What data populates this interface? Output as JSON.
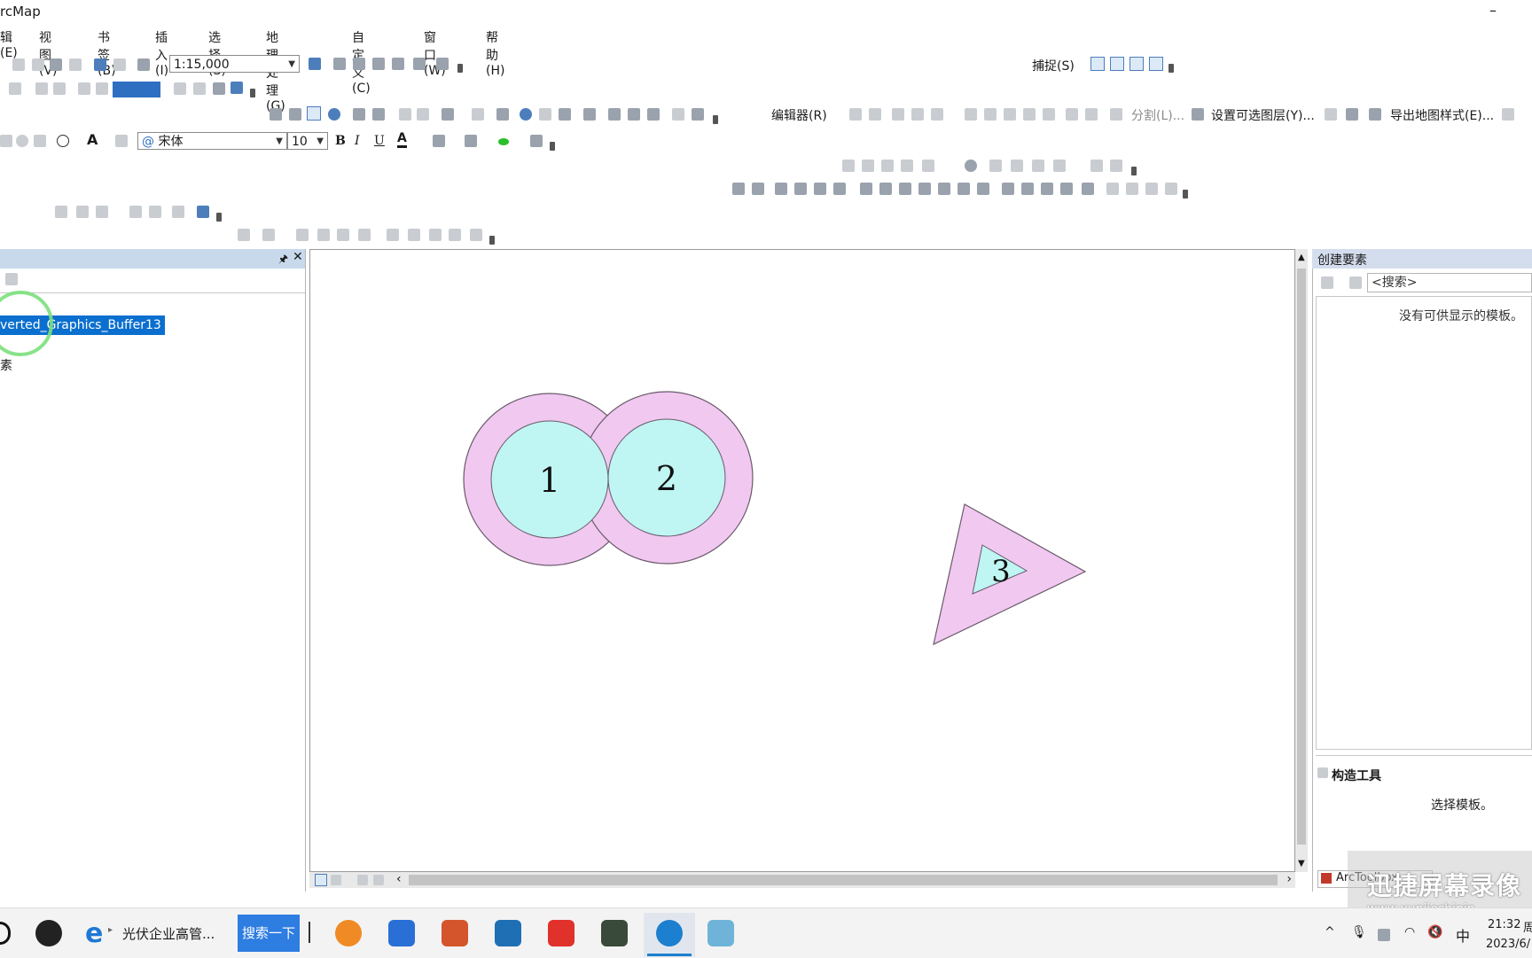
{
  "window": {
    "title": "rcMap",
    "minimize": "–"
  },
  "menu": [
    "辑(E)",
    "视图(V)",
    "书签(B)",
    "插入(I)",
    "选择(S)",
    "地理处理(G)",
    "自定义(C)",
    "窗口(W)",
    "帮助(H)"
  ],
  "toolbar": {
    "scale": "1:15,000",
    "snap_label": "捕捉(S)",
    "font_name": "宋体",
    "font_size": "10",
    "bold": "B",
    "italic": "I",
    "underline": "U",
    "editor_label": "编辑器(R)",
    "split_label": "分割(L)...",
    "selectable_label": "设置可选图层(Y)...",
    "export_label": "导出地图样式(E)..."
  },
  "toc": {
    "selected_layer": "verted_Graphics_Buffer13",
    "sub_item": "素"
  },
  "map": {
    "labels": [
      "1",
      "2",
      "3"
    ],
    "colors": {
      "outer_fill": "#f0c8f0",
      "inner_fill": "#bff5f2",
      "stroke": "#6a5a6a"
    }
  },
  "create_features": {
    "title": "创建要素",
    "search_placeholder": "<搜索>",
    "empty_msg": "没有可供显示的模板。",
    "construct_title": "构造工具",
    "construct_msg": "选择模板。",
    "arctoolbox_tab": "ArcToolbox"
  },
  "taskbar": {
    "browser_label": "光伏企业高管...",
    "search_button": "搜索一下",
    "time": "21:32",
    "weekday": "周",
    "date": "2023/6/",
    "ime": "中"
  },
  "watermark": {
    "line1": "迅捷屏幕录像",
    "line2": "www.xunjieshipin"
  }
}
